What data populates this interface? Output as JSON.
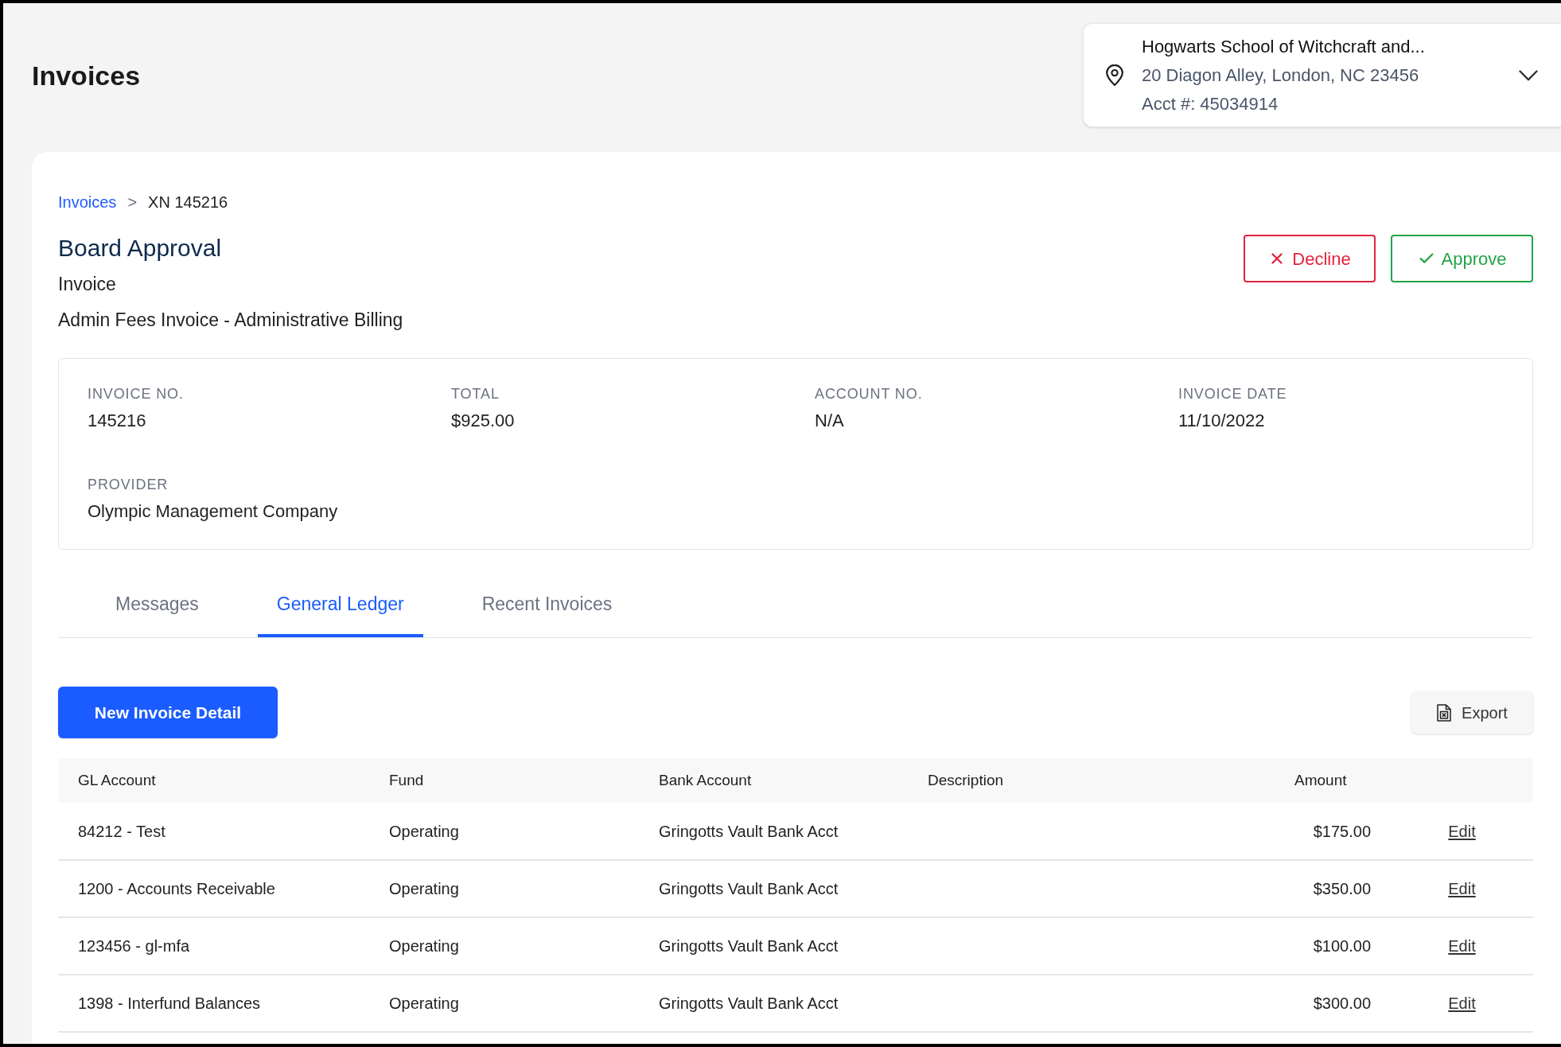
{
  "page": {
    "title": "Invoices"
  },
  "location": {
    "name": "Hogwarts School of Witchcraft and...",
    "address": "20 Diagon Alley, London, NC 23456",
    "account": "Acct #: 45034914"
  },
  "breadcrumb": {
    "separator": ">",
    "items": [
      {
        "label": "Invoices",
        "kind": "link"
      },
      {
        "label": "XN 145216",
        "kind": "current"
      }
    ]
  },
  "header": {
    "title": "Board Approval",
    "subtitle": "Invoice",
    "description": "Admin Fees Invoice - Administrative Billing"
  },
  "actions": [
    {
      "label": "Decline",
      "kind": "decline"
    },
    {
      "label": "Approve",
      "kind": "approve"
    }
  ],
  "summary": {
    "fields": [
      {
        "label": "INVOICE NO.",
        "value": "145216"
      },
      {
        "label": "TOTAL",
        "value": "$925.00"
      },
      {
        "label": "ACCOUNT NO.",
        "value": "N/A"
      },
      {
        "label": "INVOICE DATE",
        "value": "11/10/2022"
      },
      {
        "label": "PROVIDER",
        "value": "Olympic Management Company"
      }
    ]
  },
  "tabs": [
    {
      "label": "Messages",
      "selected": false
    },
    {
      "label": "General Ledger",
      "selected": true
    },
    {
      "label": "Recent Invoices",
      "selected": false
    }
  ],
  "toolbar": {
    "primary_button": "New Invoice Detail",
    "export_button": "Export"
  },
  "table": {
    "columns": [
      "GL Account",
      "Fund",
      "Bank Account",
      "Description",
      "Amount"
    ],
    "rows": [
      {
        "gl_account": "84212 - Test",
        "fund": "Operating",
        "bank_account": "Gringotts Vault Bank Acct",
        "amount": "$175.00",
        "action": "Edit"
      },
      {
        "gl_account": "1200 - Accounts Receivable",
        "fund": "Operating",
        "bank_account": "Gringotts Vault Bank Acct",
        "amount": "$350.00",
        "action": "Edit"
      },
      {
        "gl_account": "123456 - gl-mfa",
        "fund": "Operating",
        "bank_account": "Gringotts Vault Bank Acct",
        "amount": "$100.00",
        "action": "Edit"
      },
      {
        "gl_account": "1398 - Interfund Balances",
        "fund": "Operating",
        "bank_account": "Gringotts Vault Bank Acct",
        "amount": "$300.00",
        "action": "Edit"
      }
    ]
  }
}
